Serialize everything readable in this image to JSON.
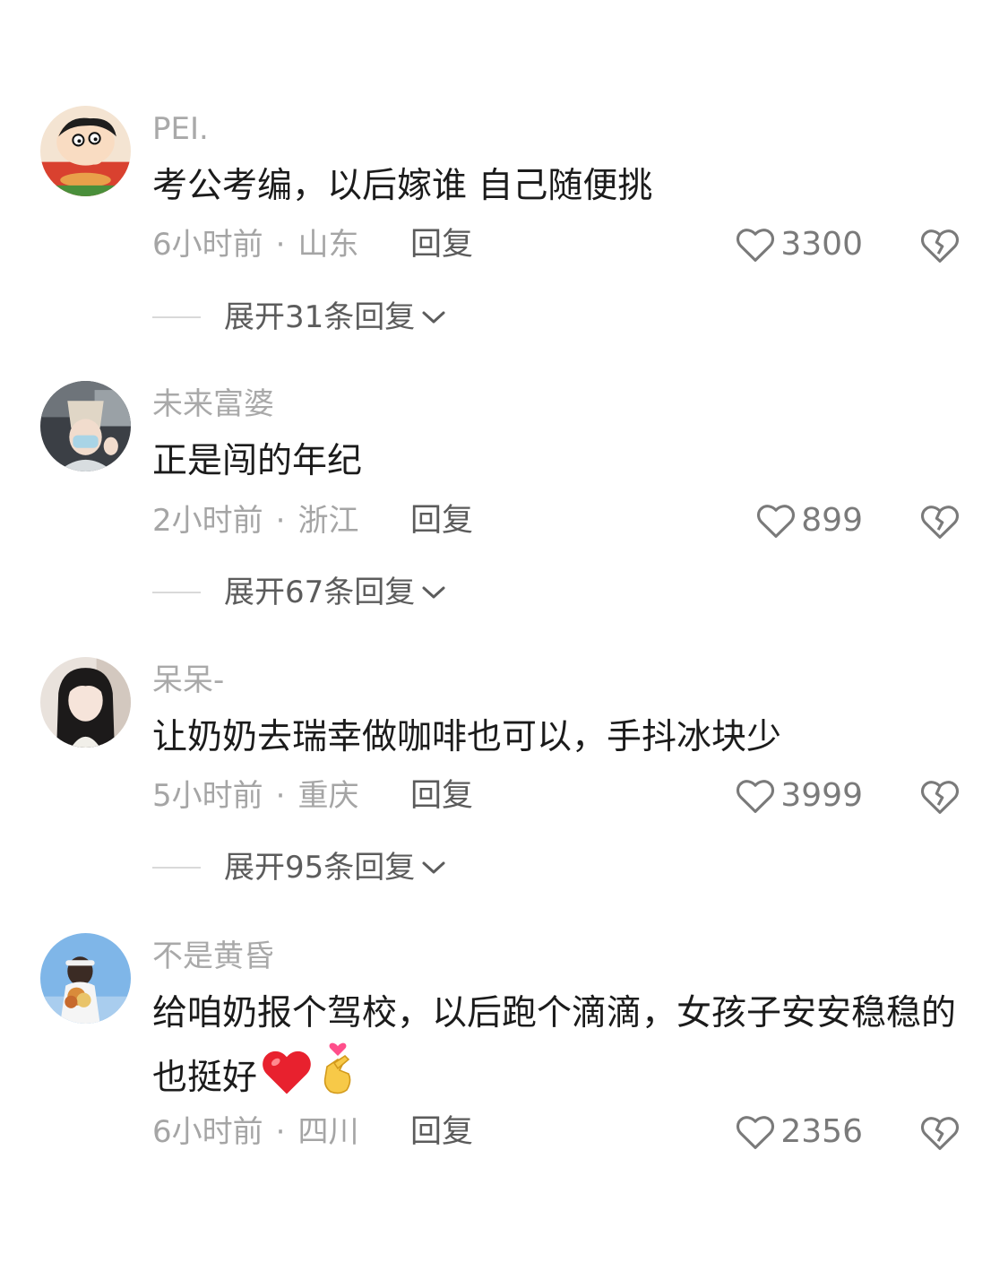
{
  "comments": [
    {
      "username": "PEI.",
      "text": "考公考编，以后嫁谁 自己随便挑",
      "time": "6小时前",
      "location": "山东",
      "reply_label": "回复",
      "likes": "3300",
      "expand_label": "展开31条回复"
    },
    {
      "username": "未来富婆",
      "text": "正是闯的年纪",
      "time": "2小时前",
      "location": "浙江",
      "reply_label": "回复",
      "likes": "899",
      "expand_label": "展开67条回复"
    },
    {
      "username": "呆呆-",
      "text": "让奶奶去瑞幸做咖啡也可以，手抖冰块少",
      "time": "5小时前",
      "location": "重庆",
      "reply_label": "回复",
      "likes": "3999",
      "expand_label": "展开95条回复"
    },
    {
      "username": "不是黄昏",
      "text": "给咱奶报个驾校，以后跑个滴滴，女孩子安安稳稳的也挺好",
      "time": "6小时前",
      "location": "四川",
      "reply_label": "回复",
      "likes": "2356",
      "emojis": [
        "red-heart-emoji",
        "finger-heart-emoji"
      ]
    }
  ],
  "separator": "·",
  "colors": {
    "username": "#a9a9a9",
    "comment_text": "#1b1b1b",
    "meta": "#a5a5a5",
    "icon": "#7a7a7a",
    "heart_emoji": "#e8212e"
  },
  "icons": {
    "like": "heart-outline-icon",
    "dislike": "broken-heart-icon",
    "expand": "chevron-down-icon"
  }
}
